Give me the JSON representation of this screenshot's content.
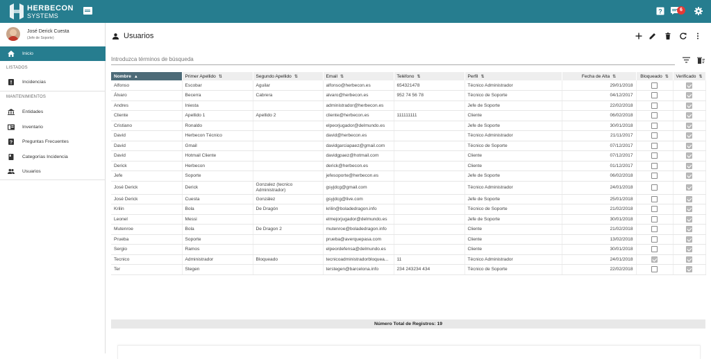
{
  "topbar": {
    "logo_line1": "HERBECON",
    "logo_line2": "SYSTEMS",
    "notifications_count": "6",
    "icons": [
      "menu-icon",
      "help-icon",
      "messages-icon",
      "settings-icon"
    ]
  },
  "sidebar": {
    "user_name": "José Derick Cuesta",
    "user_role": "(Jefe de Soporte)",
    "home_label": "Inicio",
    "section_listados": "LISTADOS",
    "incidencias": "Incidencias",
    "section_mantenimientos": "MANTENIMIENTOS",
    "items": [
      "Entidades",
      "Inventario",
      "Preguntas Frecuentes",
      "Categorías Incidencia",
      "Usuarios"
    ]
  },
  "main": {
    "title": "Usuarios",
    "search_placeholder": "Introduzca términos de búsqueda",
    "footer": "Número Total de Registros: 19"
  },
  "table": {
    "headers": [
      "Nombre",
      "Primer Apellido",
      "Segundo Apellido",
      "Email",
      "Teléfono",
      "Perfil",
      "Fecha de Alta",
      "Bloqueado",
      "Verificado"
    ],
    "rows": [
      [
        "Alfonso",
        "Escobar",
        "Aguilar",
        "alfonso@herbecon.es",
        "654321478",
        "Técnico Administrador",
        "29/01/2018",
        false,
        true
      ],
      [
        "Álvaro",
        "Becerra",
        "Cabrera",
        "alvaro@herbecon.es",
        "952 74 56 78",
        "Técnico de Soporte",
        "04/12/2017",
        false,
        true
      ],
      [
        "Andres",
        "Iniesta",
        "",
        "administrador@herbecon.es",
        "",
        "Jefe de Soporte",
        "22/02/2018",
        false,
        true
      ],
      [
        "Cliente",
        "Apellido 1",
        "Apellido 2",
        "cliente@herbecon.es",
        "111111111",
        "Cliente",
        "06/02/2018",
        false,
        true
      ],
      [
        "Cristiano",
        "Ronaldo",
        "",
        "elpeorjugador@delmundo.es",
        "",
        "Jefe de Soporte",
        "30/01/2018",
        false,
        true
      ],
      [
        "David",
        "Herbecon Técnico",
        "",
        "david@herbecon.es",
        "",
        "Técnico Administrador",
        "21/11/2017",
        false,
        true
      ],
      [
        "David",
        "Gmail",
        "",
        "davidgarciapaez@gmail.com",
        "",
        "Técnico de Soporte",
        "07/12/2017",
        false,
        true
      ],
      [
        "David",
        "Hotmail Cliente",
        "",
        "davidgpaez@hotmail.com",
        "",
        "Cliente",
        "07/12/2017",
        false,
        true
      ],
      [
        "Derick",
        "Herbecon",
        "",
        "derick@herbecon.es",
        "",
        "Cliente",
        "01/12/2017",
        false,
        true
      ],
      [
        "Jefe",
        "Soporte",
        "",
        "jefesoporte@herbecon.es",
        "",
        "Jefe de Soporte",
        "06/02/2018",
        false,
        true
      ],
      [
        "José Derick",
        "Derick",
        "Gonzalez (tecnico Administrador)",
        "gsyjdcg@gmail.com",
        "",
        "Técnico Administrador",
        "24/01/2018",
        false,
        true
      ],
      [
        "José Derick",
        "Cuesta",
        "González",
        "gsyjdcg@live.com",
        "",
        "Jefe de Soporte",
        "25/01/2018",
        false,
        true
      ],
      [
        "Krilin",
        "Bola",
        "De Dragón",
        "krilin@boladedragon.info",
        "",
        "Técnico de Soporte",
        "21/02/2018",
        false,
        true
      ],
      [
        "Leonel",
        "Messi",
        "",
        "elmejorjugador@delmundo.es",
        "",
        "Jefe de Soporte",
        "30/01/2018",
        false,
        true
      ],
      [
        "Mutenroe",
        "Bola",
        "De Dragon 2",
        "mutenroe@boladedragon.info",
        "",
        "Cliente",
        "21/02/2018",
        false,
        true
      ],
      [
        "Prueba",
        "Soporte",
        "",
        "prueba@averquepasa.com",
        "",
        "Cliente",
        "13/02/2018",
        false,
        true
      ],
      [
        "Sergio",
        "Ramos",
        "",
        "elpeordefensa@delmundo.es",
        "",
        "Cliente",
        "30/01/2018",
        false,
        true
      ],
      [
        "Tecnico",
        "Administrador",
        "Bloqueado",
        "tecnicoadministradorbloquea...",
        "11",
        "Técnico Administrador",
        "24/01/2018",
        true,
        true
      ],
      [
        "Ter",
        "Stegen",
        "",
        "terstegen@barcelona.info",
        "234 243234 434",
        "Técnico de Soporte",
        "22/02/2018",
        false,
        true
      ]
    ]
  },
  "colors": {
    "primary": "#267d8f",
    "sorted_header": "#4d6b78",
    "badge": "#e53935"
  }
}
